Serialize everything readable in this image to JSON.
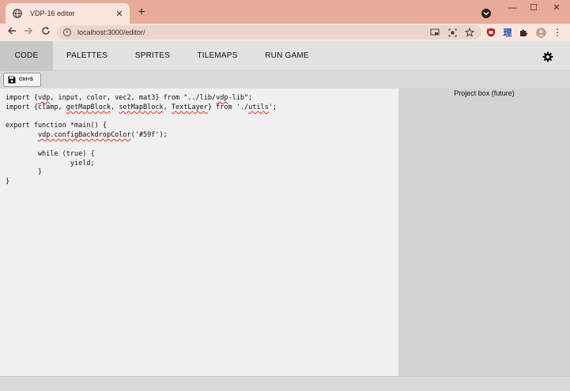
{
  "browser": {
    "tab_title": "VDP-16 editor",
    "tab_close": "✕",
    "new_tab": "+",
    "window_min": "—",
    "window_max": "☐",
    "window_close": "✕",
    "url": "localhost:3000/editor/",
    "info_glyph": "i",
    "kanji_extension": "理",
    "menu_glyph": "⋮"
  },
  "nav": {
    "tabs": [
      {
        "label": "CODE",
        "active": true
      },
      {
        "label": "PALETTES",
        "active": false
      },
      {
        "label": "SPRITES",
        "active": false
      },
      {
        "label": "TILEMAPS",
        "active": false
      },
      {
        "label": "RUN GAME",
        "active": false
      }
    ]
  },
  "toolbar": {
    "save_label": "Ctrl+S"
  },
  "editor": {
    "lines": [
      [
        {
          "t": "import {"
        },
        {
          "t": "vdp",
          "u": true
        },
        {
          "t": ", input, color, vec2, mat3} from \"../lib/"
        },
        {
          "t": "vdp",
          "u": true
        },
        {
          "t": "-lib\";"
        }
      ],
      [
        {
          "t": "import {clamp, "
        },
        {
          "t": "getMapBlock",
          "u": true
        },
        {
          "t": ", "
        },
        {
          "t": "setMapBlock",
          "u": true
        },
        {
          "t": ", "
        },
        {
          "t": "TextLayer",
          "u": true
        },
        {
          "t": "} from './"
        },
        {
          "t": "utils",
          "u": true
        },
        {
          "t": "';"
        }
      ],
      [
        {
          "t": ""
        }
      ],
      [
        {
          "t": "export function *main() {"
        }
      ],
      [
        {
          "t": "        "
        },
        {
          "t": "vdp.configBackdropColor",
          "u": true
        },
        {
          "t": "('#59f');"
        }
      ],
      [
        {
          "t": ""
        }
      ],
      [
        {
          "t": "        while (true) {"
        }
      ],
      [
        {
          "t": "                yield;"
        }
      ],
      [
        {
          "t": "        }"
        }
      ],
      [
        {
          "t": "}"
        }
      ]
    ]
  },
  "project": {
    "title": "Project box (future)"
  },
  "colors": {
    "titlebar": "#e8aa99",
    "tab_bg": "#fbe5df",
    "squiggle": "#e0302c"
  }
}
